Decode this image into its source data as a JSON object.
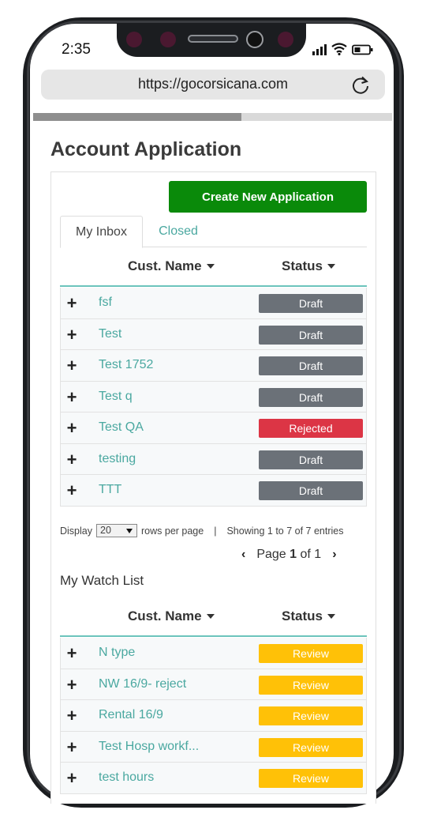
{
  "status_bar": {
    "time": "2:35"
  },
  "browser": {
    "url": "https://gocorsicana.com",
    "progress": 0.58
  },
  "page": {
    "title": "Account Application",
    "create_button": "Create New Application",
    "tabs": [
      {
        "label": "My Inbox",
        "active": true
      },
      {
        "label": "Closed",
        "active": false
      }
    ]
  },
  "inbox": {
    "columns": {
      "name": "Cust. Name",
      "status": "Status"
    },
    "rows": [
      {
        "name": "fsf",
        "status": "Draft"
      },
      {
        "name": "Test",
        "status": "Draft"
      },
      {
        "name": "Test 1752",
        "status": "Draft"
      },
      {
        "name": "Test q",
        "status": "Draft"
      },
      {
        "name": "Test QA",
        "status": "Rejected"
      },
      {
        "name": "testing",
        "status": "Draft"
      },
      {
        "name": "TTT",
        "status": "Draft"
      }
    ],
    "pagination": {
      "display_label": "Display",
      "rows_value": "20",
      "rows_suffix": "rows per page",
      "separator": "|",
      "showing": "Showing 1 to 7 of 7 entries",
      "page_prefix": "Page",
      "page_current": "1",
      "page_of": "of 1"
    }
  },
  "watchlist": {
    "title": "My Watch List",
    "columns": {
      "name": "Cust. Name",
      "status": "Status"
    },
    "rows": [
      {
        "name": "N type",
        "status": "Review"
      },
      {
        "name": "NW 16/9- reject",
        "status": "Review"
      },
      {
        "name": "Rental 16/9",
        "status": "Review"
      },
      {
        "name": "Test Hosp workf...",
        "status": "Review"
      },
      {
        "name": "test hours",
        "status": "Review"
      }
    ]
  },
  "colors": {
    "create_button": "#0a8a0a",
    "link": "#4aa8a0",
    "draft": "#6b7178",
    "rejected": "#dc3545",
    "review": "#ffc107",
    "header_rule": "#6cc4bc"
  }
}
